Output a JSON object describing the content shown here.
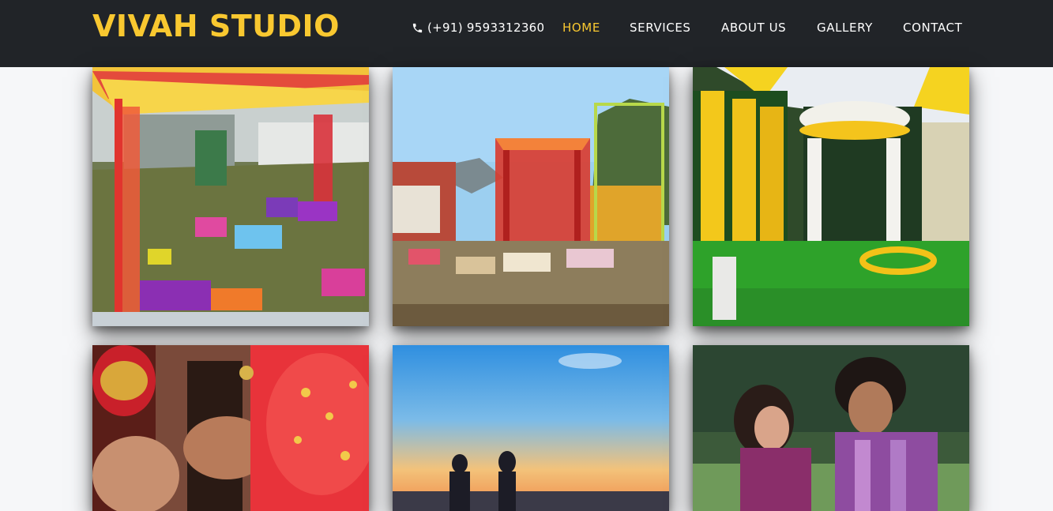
{
  "brand": {
    "name": "VIVAH STUDIO"
  },
  "header": {
    "phone_icon": "phone-icon",
    "phone": "(+91) 9593312360"
  },
  "nav": {
    "items": [
      {
        "label": "HOME",
        "active": true
      },
      {
        "label": "SERVICES",
        "active": false
      },
      {
        "label": "ABOUT US",
        "active": false
      },
      {
        "label": "GALLERY",
        "active": false
      },
      {
        "label": "CONTACT",
        "active": false
      }
    ]
  },
  "colors": {
    "navbar_bg": "#212428",
    "accent": "#f9c830",
    "page_bg": "#f6f7f9"
  },
  "gallery": {
    "images": [
      {
        "subject": "colorful mehendi decor lawn with red drapes"
      },
      {
        "subject": "outdoor wedding venue with red canopy and chairs"
      },
      {
        "subject": "yellow marigold stage with white drapes"
      },
      {
        "subject": "groom with ring during ceremony"
      },
      {
        "subject": "couple silhouette at sunset"
      },
      {
        "subject": "couple portrait outdoors"
      }
    ]
  }
}
